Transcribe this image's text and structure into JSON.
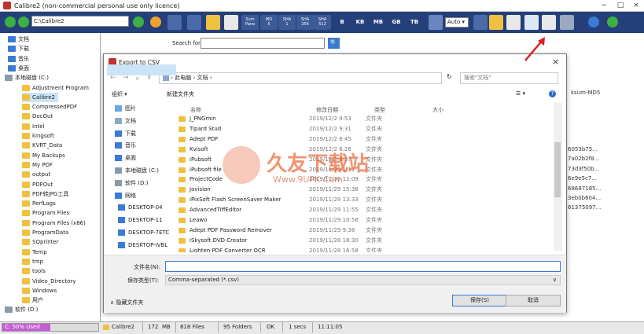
{
  "app": {
    "title": "Calibre2 (non-commercial personal use only licence)",
    "path_value": "C:\\Calibre2",
    "toolbar": {
      "sum_label": "Sum\nPane",
      "md5_label": "MD\n5",
      "sha1_label": "SHA\n1",
      "sha256_label": "SHA\n256",
      "sha512_label": "SHA\n512",
      "unit_b": "B",
      "unit_kb": "KB",
      "unit_mb": "MB",
      "unit_gb": "GB",
      "unit_tb": "TB",
      "auto_select": "Auto"
    }
  },
  "tree": {
    "items": [
      {
        "label": "文档",
        "type": "blue"
      },
      {
        "label": "下载",
        "type": "blue"
      },
      {
        "label": "音乐",
        "type": "blue"
      },
      {
        "label": "桌面",
        "type": "blue"
      },
      {
        "label": "本地磁盘 (C:)",
        "type": "drive"
      },
      {
        "label": "Adjustment Program",
        "type": "folder"
      },
      {
        "label": "Calibre2",
        "type": "folder"
      },
      {
        "label": "CompressedPDF",
        "type": "folder"
      },
      {
        "label": "DocOut",
        "type": "folder"
      },
      {
        "label": "Intel",
        "type": "folder"
      },
      {
        "label": "kingsoft",
        "type": "folder"
      },
      {
        "label": "KVRT_Data",
        "type": "folder"
      },
      {
        "label": "My Backups",
        "type": "folder"
      },
      {
        "label": "My PDF",
        "type": "folder"
      },
      {
        "label": "output",
        "type": "folder"
      },
      {
        "label": "PDFOut",
        "type": "folder"
      },
      {
        "label": "PDF转JPG工具",
        "type": "folder"
      },
      {
        "label": "PerfLogs",
        "type": "folder"
      },
      {
        "label": "Program Files",
        "type": "folder"
      },
      {
        "label": "Program Files (x86)",
        "type": "folder"
      },
      {
        "label": "ProgramData",
        "type": "folder"
      },
      {
        "label": "SQprinter",
        "type": "folder"
      },
      {
        "label": "Temp",
        "type": "folder"
      },
      {
        "label": "tmp",
        "type": "folder"
      },
      {
        "label": "tools",
        "type": "folder"
      },
      {
        "label": "Video_Directory",
        "type": "folder"
      },
      {
        "label": "Windows",
        "type": "folder"
      },
      {
        "label": "用户",
        "type": "folder"
      },
      {
        "label": "软件 (D:)",
        "type": "drive"
      }
    ]
  },
  "right_pane": {
    "search_label": "Search for",
    "hash_header": "ksum-MD5",
    "hashes": [
      "6053b75...",
      "7a02b2f8...",
      "73d3f50b...",
      "6e9e5c7...",
      "68687185...",
      "3eb0b604...",
      "61375097..."
    ]
  },
  "statusbar": {
    "used_label": "C: 50% Used",
    "used_fraction": 0.5,
    "folder_name": "Calibre2",
    "size_value": "172",
    "size_unit": "MB",
    "files": "818 Files",
    "folders": "95 Folders",
    "status": "OK",
    "duration": "1 secs",
    "time": "11:11:05"
  },
  "dialog": {
    "title": "Export to CSV",
    "breadcrumb_pc": "此电脑",
    "breadcrumb_folder": "文档",
    "search_placeholder": "搜索\"文档\"",
    "organize": "组织 ▾",
    "new_folder": "新建文件夹",
    "nav_items": [
      {
        "label": "图片",
        "icon": "pictures-icon"
      },
      {
        "label": "文档",
        "icon": "documents-icon"
      },
      {
        "label": "下载",
        "icon": "download-icon"
      },
      {
        "label": "音乐",
        "icon": "music-icon"
      },
      {
        "label": "桌面",
        "icon": "desktop-icon"
      },
      {
        "label": "本地磁盘 (C:)",
        "icon": "drive-icon"
      },
      {
        "label": "软件 (D:)",
        "icon": "drive-icon"
      },
      {
        "label": "网络",
        "icon": "network-icon"
      },
      {
        "label": "DESKTOP-04",
        "icon": "computer-icon"
      },
      {
        "label": "DESKTOP-11",
        "icon": "computer-icon"
      },
      {
        "label": "DESKTOP-7ETC",
        "icon": "computer-icon"
      },
      {
        "label": "DESKTOP-IVBL",
        "icon": "computer-icon"
      }
    ],
    "columns": {
      "name": "名称",
      "date": "修改日期",
      "type": "类型",
      "size": "大小"
    },
    "files": [
      {
        "name": "J_PNGmin",
        "date": "2019/12/2 9:53",
        "type": "文件夹"
      },
      {
        "name": "Tipard Stud",
        "date": "2019/12/2 9:31",
        "type": "文件夹"
      },
      {
        "name": "Adept PDF",
        "date": "2019/12/2 8:45",
        "type": "文件夹"
      },
      {
        "name": "Kvisoft",
        "date": "2019/12/2 8:26",
        "type": "文件夹"
      },
      {
        "name": "iPubsoft",
        "date": "2019/12/2 8:17",
        "type": "文件夹"
      },
      {
        "name": "iPubsoft file",
        "date": "2019/11/30 1:11",
        "type": "文件夹"
      },
      {
        "name": "ProjectCode",
        "date": "2019/11/30 11:09",
        "type": "文件夹"
      },
      {
        "name": "Jovision",
        "date": "2019/11/29 15:38",
        "type": "文件夹"
      },
      {
        "name": "iPixSoft Flash ScreenSaver Maker",
        "date": "2019/11/29 13:33",
        "type": "文件夹"
      },
      {
        "name": "AdvancedTiffEditor",
        "date": "2019/11/29 11:55",
        "type": "文件夹"
      },
      {
        "name": "Leawo",
        "date": "2019/11/29 10:58",
        "type": "文件夹"
      },
      {
        "name": "Adept PDF Password Remover",
        "date": "2019/11/29 9:38",
        "type": "文件夹"
      },
      {
        "name": "iSkysoft DVD Creator",
        "date": "2019/11/28 18:30",
        "type": "文件夹"
      },
      {
        "name": "Lighten PDF Converter OCR",
        "date": "2019/11/28 16:58",
        "type": "文件夹"
      }
    ],
    "filename_label": "文件名(N):",
    "filename_value": "",
    "filetype_label": "保存类型(T):",
    "filetype_value": "Comma-separated (*.csv)",
    "hide_folders": "隐藏文件夹",
    "save_button": "保存(S)",
    "cancel_button": "取消"
  },
  "watermark": {
    "text": "久友下载站",
    "url": "Www.9UPK.Com"
  },
  "colors": {
    "toolbar_bg": "#243f7a",
    "used_fill": "#c75bd6",
    "folder": "#f0c040",
    "accent": "#3a7bd5",
    "arrow": "#d42020"
  }
}
